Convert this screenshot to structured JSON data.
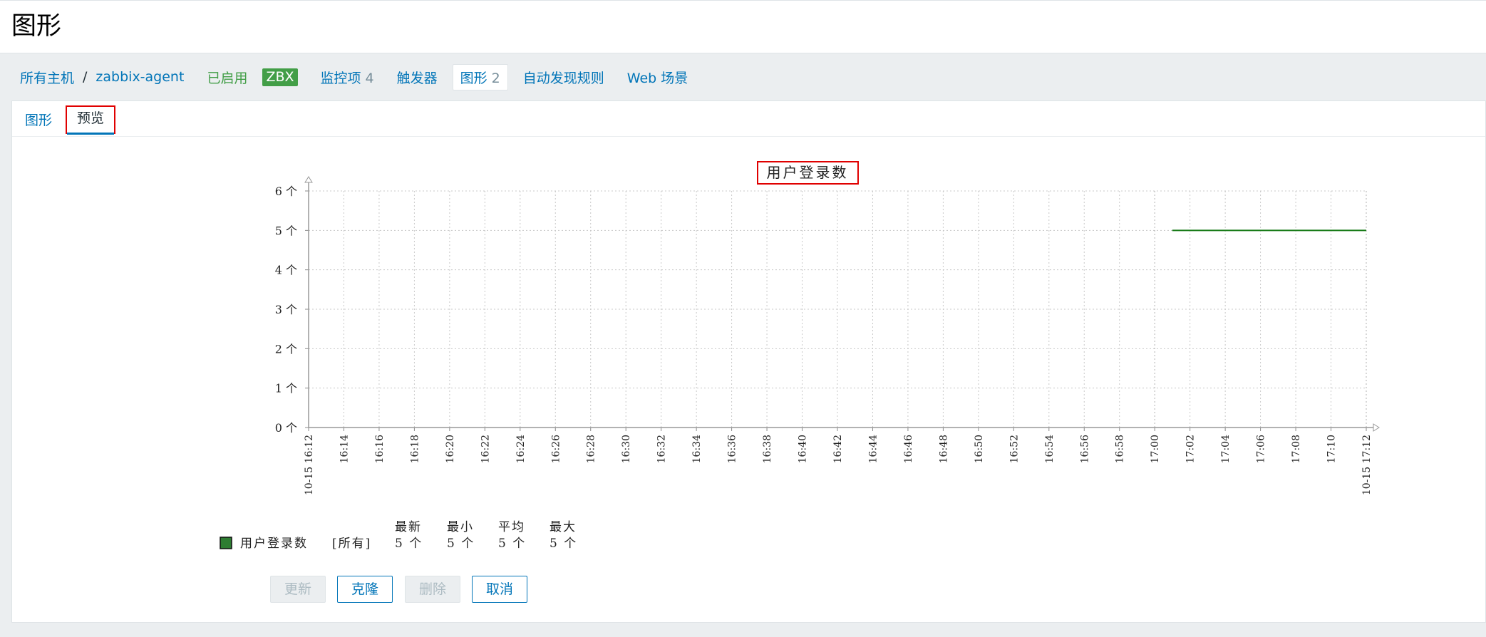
{
  "page_title": "图形",
  "host_nav": {
    "all_hosts": "所有主机",
    "separator": "/",
    "host_name": "zabbix-agent",
    "status": "已启用",
    "zbx": "ZBX",
    "items_label": "监控项",
    "items_count": "4",
    "triggers_label": "触发器",
    "graphs_label": "图形",
    "graphs_count": "2",
    "discovery_label": "自动发现规则",
    "web_label": "Web 场景"
  },
  "tabs": [
    {
      "label": "图形"
    },
    {
      "label": "预览"
    }
  ],
  "chart_data": {
    "type": "line",
    "title": "用户登录数",
    "y_ticks": [
      "0 个",
      "1 个",
      "2 个",
      "3 个",
      "4 个",
      "5 个",
      "6 个"
    ],
    "ylim": [
      0,
      6
    ],
    "x_ticks": [
      "10-15 16:12",
      "16:14",
      "16:16",
      "16:18",
      "16:20",
      "16:22",
      "16:24",
      "16:26",
      "16:28",
      "16:30",
      "16:32",
      "16:34",
      "16:36",
      "16:38",
      "16:40",
      "16:42",
      "16:44",
      "16:46",
      "16:48",
      "16:50",
      "16:52",
      "16:54",
      "16:56",
      "16:58",
      "17:00",
      "17:02",
      "17:04",
      "17:06",
      "17:08",
      "17:10",
      "10-15 17:12"
    ],
    "highlight_x_ticks": [
      "10-15 16:12",
      "17:00",
      "10-15 17:12"
    ],
    "xlim": [
      "16:12",
      "17:12"
    ],
    "grid": true,
    "series": [
      {
        "name": "用户登录数",
        "color": "#1a7c1a",
        "points": [
          {
            "x": "17:01",
            "y": 5
          },
          {
            "x": "17:12",
            "y": 5
          }
        ]
      }
    ],
    "legend": {
      "series_name": "用户登录数",
      "function": "[所有]",
      "headers": [
        "最新",
        "最小",
        "平均",
        "最大"
      ],
      "values": [
        "5 个",
        "5 个",
        "5 个",
        "5 个"
      ],
      "swatch_color": "#2e7d32"
    }
  },
  "buttons": {
    "update": "更新",
    "clone": "克隆",
    "delete": "删除",
    "cancel": "取消"
  }
}
